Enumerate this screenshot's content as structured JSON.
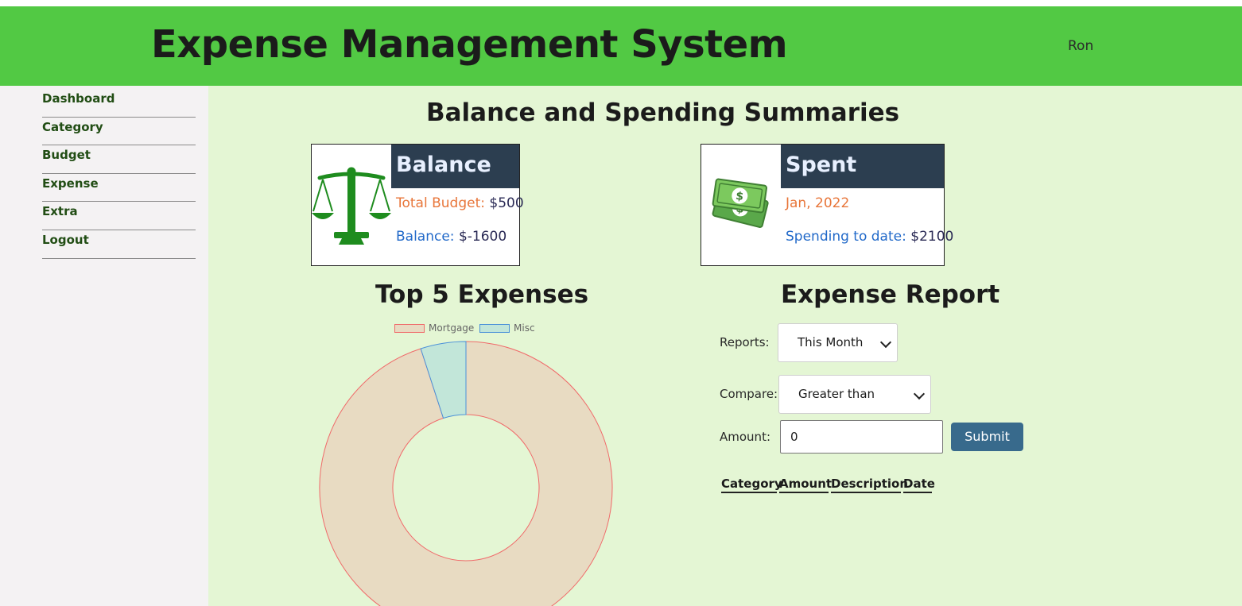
{
  "header": {
    "title": "Expense Management System",
    "user": "Ron"
  },
  "sidebar": {
    "items": [
      {
        "label": "Dashboard"
      },
      {
        "label": "Category"
      },
      {
        "label": "Budget"
      },
      {
        "label": "Expense"
      },
      {
        "label": "Extra"
      },
      {
        "label": "Logout"
      }
    ]
  },
  "main": {
    "title": "Balance and Spending Summaries",
    "balance_card": {
      "heading": "Balance",
      "budget_label": "Total Budget:",
      "budget_value": "$500",
      "balance_label": "Balance:",
      "balance_value": "$-1600",
      "icon": "scales-icon"
    },
    "spent_card": {
      "heading": "Spent",
      "period": "Jan, 2022",
      "spending_label": "Spending to date:",
      "spending_value": "$2100",
      "icon": "money-icon"
    },
    "top_expenses_title": "Top 5 Expenses",
    "report": {
      "title": "Expense Report",
      "reports_label": "Reports:",
      "reports_value": "This Month",
      "compare_label": "Compare:",
      "compare_value": "Greater than",
      "amount_label": "Amount:",
      "amount_value": "0",
      "submit_label": "Submit",
      "table_headers": [
        "Category",
        "Amount",
        "Description",
        "Date"
      ]
    }
  },
  "colors": {
    "header_bg": "#52c944",
    "card_head_bg": "#2c3e50",
    "submit_bg": "#386a8c"
  },
  "chart_data": {
    "type": "pie",
    "title": "Top 5 Expenses",
    "legend_position": "top",
    "series": [
      {
        "name": "Mortgage",
        "value": 95,
        "fill": "#e8dbc2",
        "stroke": "#f06a6a"
      },
      {
        "name": "Misc",
        "value": 5,
        "fill": "#c2e6d9",
        "stroke": "#4a90d9"
      }
    ]
  }
}
